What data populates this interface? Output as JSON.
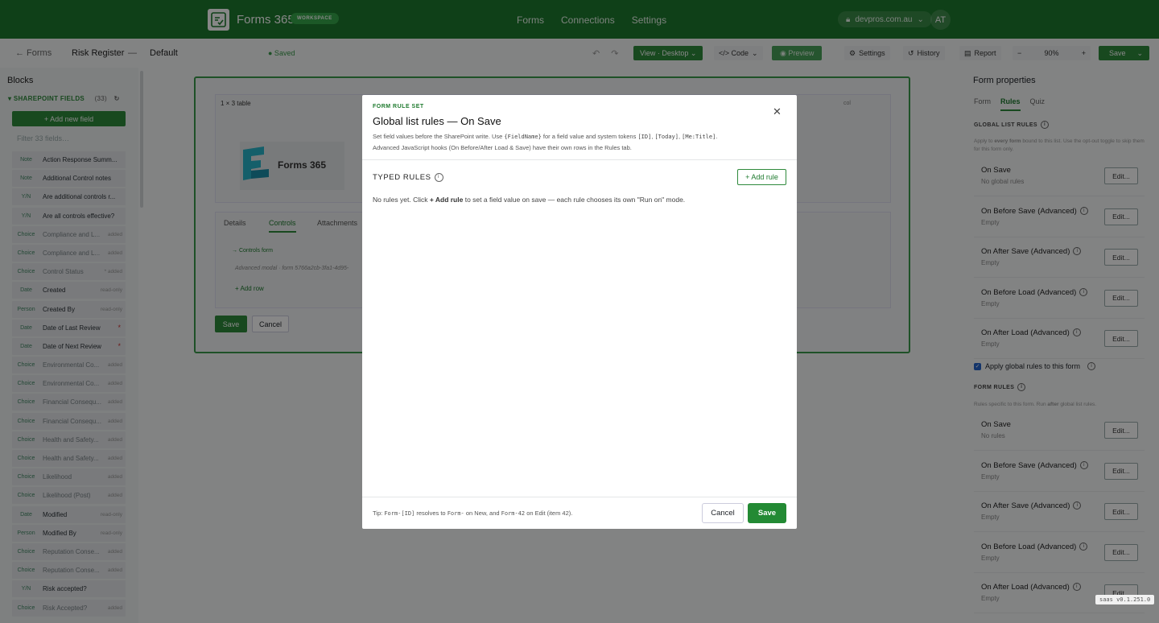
{
  "topbar": {
    "app_title": "Forms 365",
    "badge": "WORKSPACE",
    "nav": [
      "Forms",
      "Connections",
      "Settings"
    ],
    "tenant": "devpros.com.au",
    "avatar": "AT"
  },
  "toolbar": {
    "back": "← Forms",
    "form_name": "Risk Register",
    "separator": "—",
    "view_name": "Default",
    "saved": "● Saved",
    "view_mode": "View · Desktop",
    "code": "</> Code",
    "preview": "Preview",
    "settings": "Settings",
    "history": "History",
    "report": "Report",
    "zoom_minus": "−",
    "zoom": "90%",
    "zoom_plus": "+",
    "save": "Save"
  },
  "left": {
    "title": "Blocks",
    "section": "SHAREPOINT FIELDS",
    "count": "(33)",
    "add_field": "+ Add new field",
    "filter_placeholder": "Filter 33 fields…",
    "fields": [
      {
        "type": "Note",
        "name": "Action Response Summ...",
        "tag": ""
      },
      {
        "type": "Note",
        "name": "Additional Control notes",
        "tag": ""
      },
      {
        "type": "Y/N",
        "name": "Are additional controls r...",
        "tag": ""
      },
      {
        "type": "Y/N",
        "name": "Are all controls effective?",
        "tag": ""
      },
      {
        "type": "Choice",
        "name": "Compliance and L...",
        "tag": "added"
      },
      {
        "type": "Choice",
        "name": "Compliance and L...",
        "tag": "added"
      },
      {
        "type": "Choice",
        "name": "Control Status",
        "tag": "* added"
      },
      {
        "type": "Date",
        "name": "Created",
        "tag": "read-only"
      },
      {
        "type": "Person",
        "name": "Created By",
        "tag": "read-only"
      },
      {
        "type": "Date",
        "name": "Date of Last Review",
        "tag": "*"
      },
      {
        "type": "Date",
        "name": "Date of Next Review",
        "tag": "*"
      },
      {
        "type": "Choice",
        "name": "Environmental Co...",
        "tag": "added"
      },
      {
        "type": "Choice",
        "name": "Environmental Co...",
        "tag": "added"
      },
      {
        "type": "Choice",
        "name": "Financial Consequ...",
        "tag": "added"
      },
      {
        "type": "Choice",
        "name": "Financial Consequ...",
        "tag": "added"
      },
      {
        "type": "Choice",
        "name": "Health and Safety...",
        "tag": "added"
      },
      {
        "type": "Choice",
        "name": "Health and Safety...",
        "tag": "added"
      },
      {
        "type": "Choice",
        "name": "Likelihood",
        "tag": "added"
      },
      {
        "type": "Choice",
        "name": "Likelihood (Post)",
        "tag": "added"
      },
      {
        "type": "Date",
        "name": "Modified",
        "tag": "read-only"
      },
      {
        "type": "Person",
        "name": "Modified By",
        "tag": "read-only"
      },
      {
        "type": "Choice",
        "name": "Reputation Conse...",
        "tag": "added"
      },
      {
        "type": "Choice",
        "name": "Reputation Conse...",
        "tag": "added"
      },
      {
        "type": "Y/N",
        "name": "Risk accepted?",
        "tag": ""
      },
      {
        "type": "Choice",
        "name": "Risk Accepted?",
        "tag": "added"
      }
    ]
  },
  "canvas": {
    "table_label": "1 × 3 table",
    "col_label": "col",
    "logo_text": "Forms 365",
    "tabs": [
      "Details",
      "Controls",
      "Attachments"
    ],
    "controls_form": "→ Controls form",
    "advanced_modal": "Advanced modal · form 5766a2cb-3fa1-4d95-",
    "add_row": "+ Add row",
    "save": "Save",
    "cancel": "Cancel"
  },
  "right": {
    "title": "Form properties",
    "tabs": [
      "Form",
      "Rules",
      "Quiz"
    ],
    "global_section": "GLOBAL LIST RULES",
    "global_hint_1": "Apply to",
    "global_hint_bold": "every form",
    "global_hint_2": "bound to this list. Use the opt-out toggle to skip them for this form only.",
    "global_rules": [
      {
        "name": "On Save",
        "sub": "No global rules",
        "info": false
      },
      {
        "name": "On Before Save (Advanced)",
        "sub": "Empty",
        "info": true
      },
      {
        "name": "On After Save (Advanced)",
        "sub": "Empty",
        "info": true
      },
      {
        "name": "On Before Load (Advanced)",
        "sub": "Empty",
        "info": true
      },
      {
        "name": "On After Load (Advanced)",
        "sub": "Empty",
        "info": true
      }
    ],
    "apply_global": "Apply global rules to this form",
    "form_section": "FORM RULES",
    "form_hint_1": "Rules specific to this form. Run",
    "form_hint_bold": "after",
    "form_hint_2": "global list rules.",
    "form_rules": [
      {
        "name": "On Save",
        "sub": "No rules",
        "info": false
      },
      {
        "name": "On Before Save (Advanced)",
        "sub": "Empty",
        "info": true
      },
      {
        "name": "On After Save (Advanced)",
        "sub": "Empty",
        "info": true
      },
      {
        "name": "On Before Load (Advanced)",
        "sub": "Empty",
        "info": true
      },
      {
        "name": "On After Load (Advanced)",
        "sub": "Empty",
        "info": true
      }
    ],
    "edit_label": "Edit..."
  },
  "modal": {
    "kicker": "FORM RULE SET",
    "title": "Global list rules — On Save",
    "desc_1": "Set field values before the SharePoint write. Use ",
    "desc_code_1": "{FieldName}",
    "desc_2": " for a field value and system tokens ",
    "desc_code_2": "[ID]",
    "desc_3": ", ",
    "desc_code_3": "[Today]",
    "desc_4": ", ",
    "desc_code_4": "[Me:Title]",
    "desc_5": ".",
    "desc_line_2": "Advanced JavaScript hooks (On Before/After Load & Save) have their own rows in the Rules tab.",
    "typed_rules": "TYPED RULES",
    "add_rule": "+ Add rule",
    "empty_1": "No rules yet. Click ",
    "empty_bold": "+ Add rule",
    "empty_2": " to set a field value on save — each rule chooses its own \"Run on\" mode.",
    "tip_1": "Tip: ",
    "tip_code_1": "Form-[ID]",
    "tip_2": " resolves to ",
    "tip_code_2": "Form-",
    "tip_3": " on New, and ",
    "tip_code_3": "Form-42",
    "tip_4": " on Edit (item 42).",
    "cancel": "Cancel",
    "save": "Save"
  },
  "version": "saas v0.1.251.0",
  "colors": {
    "brand": "#1e7a2e",
    "accent": "#2f8a3c",
    "overlay": "rgba(0,0,0,0.47)"
  }
}
